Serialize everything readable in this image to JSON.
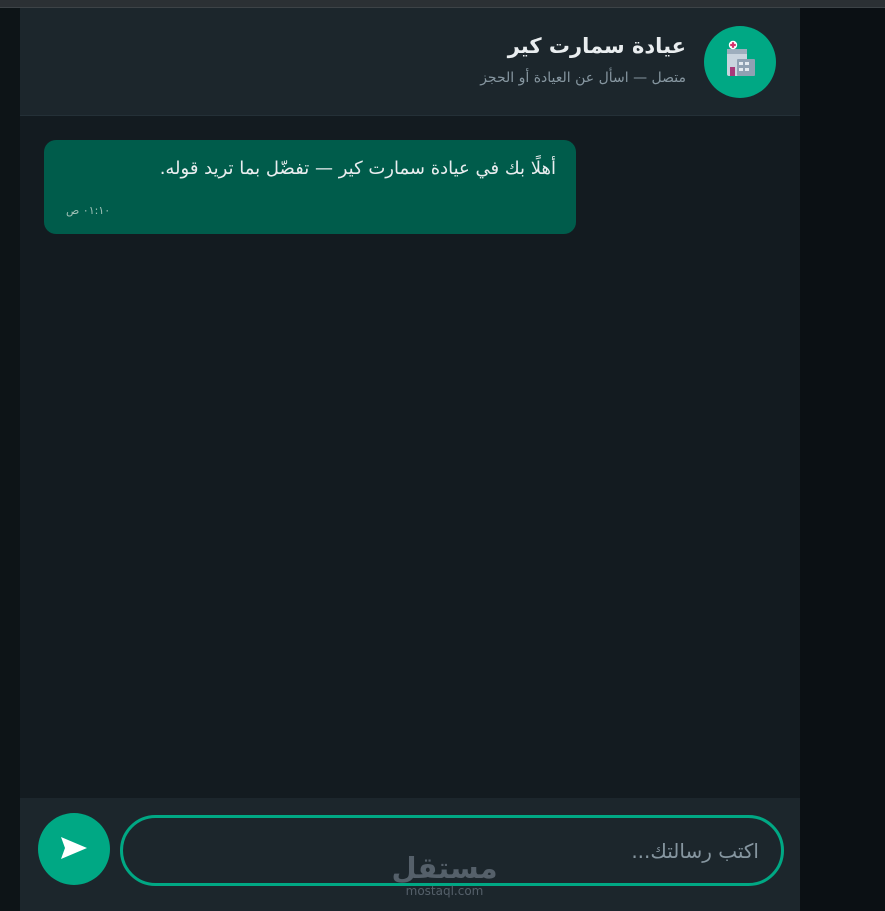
{
  "header": {
    "title": "عيادة سمارت كير",
    "subtitle": "متصل — اسأل عن العيادة أو الحجز",
    "avatar_icon": "clinic-building-icon"
  },
  "messages": [
    {
      "text": "أهلًا بك في عيادة سمارت كير — تفضّل بما تريد قوله.",
      "time": "٠١:١٠ ص"
    }
  ],
  "composer": {
    "placeholder": "اكتب رسالتك...",
    "send_icon": "send-icon"
  },
  "watermark": {
    "arabic": "مستقل",
    "latin": "mostaql.com"
  },
  "colors": {
    "accent": "#00a884",
    "bubble": "#005c4b",
    "header": "#1c262c",
    "chat_bg": "#131b20"
  }
}
